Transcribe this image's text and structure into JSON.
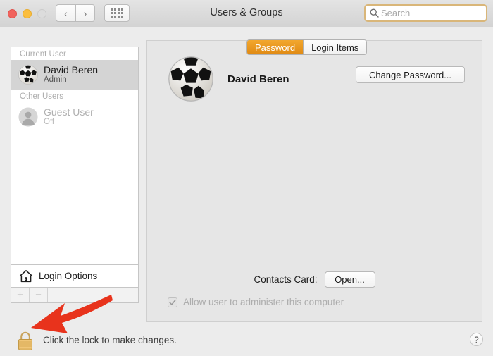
{
  "window": {
    "title": "Users & Groups",
    "traffic_lights": [
      "close",
      "minimize",
      "zoom"
    ],
    "nav": {
      "back": "‹",
      "forward": "›"
    },
    "grid_button": "show-all-icon"
  },
  "search": {
    "placeholder": "Search",
    "value": "",
    "icon": "search-icon",
    "focus_ring_color": "#d9b679"
  },
  "sidebar": {
    "groups": [
      {
        "header": "Current User",
        "users": [
          {
            "name": "David Beren",
            "role": "Admin",
            "avatar": "soccer-ball-avatar",
            "selected": true,
            "disabled": false
          }
        ]
      },
      {
        "header": "Other Users",
        "users": [
          {
            "name": "Guest User",
            "role": "Off",
            "avatar": "person-silhouette-avatar",
            "selected": false,
            "disabled": true
          }
        ]
      }
    ],
    "login_options": {
      "label": "Login Options",
      "icon": "house-icon"
    },
    "add_button": "+",
    "remove_button": "−"
  },
  "tabs": [
    {
      "label": "Password",
      "active": true
    },
    {
      "label": "Login Items",
      "active": false
    }
  ],
  "main": {
    "user_name": "David Beren",
    "avatar": "soccer-ball-avatar",
    "change_password_button": "Change Password...",
    "contacts_card_label": "Contacts Card:",
    "open_button": "Open...",
    "admin_checkbox": {
      "label": "Allow user to administer this computer",
      "checked": true,
      "disabled": true
    }
  },
  "footer": {
    "lock_icon": "closed-padlock-icon",
    "lock_text": "Click the lock to make changes.",
    "help_button": "?"
  },
  "annotation": {
    "arrow": "red-arrow-pointing-to-lock",
    "color": "#e8331c"
  },
  "colors": {
    "accent": "#e8951a",
    "window_bg": "#ececec",
    "panel_bg": "#e6e6e6",
    "sidebar_bg": "#ffffff",
    "selection": "#d4d4d4"
  }
}
